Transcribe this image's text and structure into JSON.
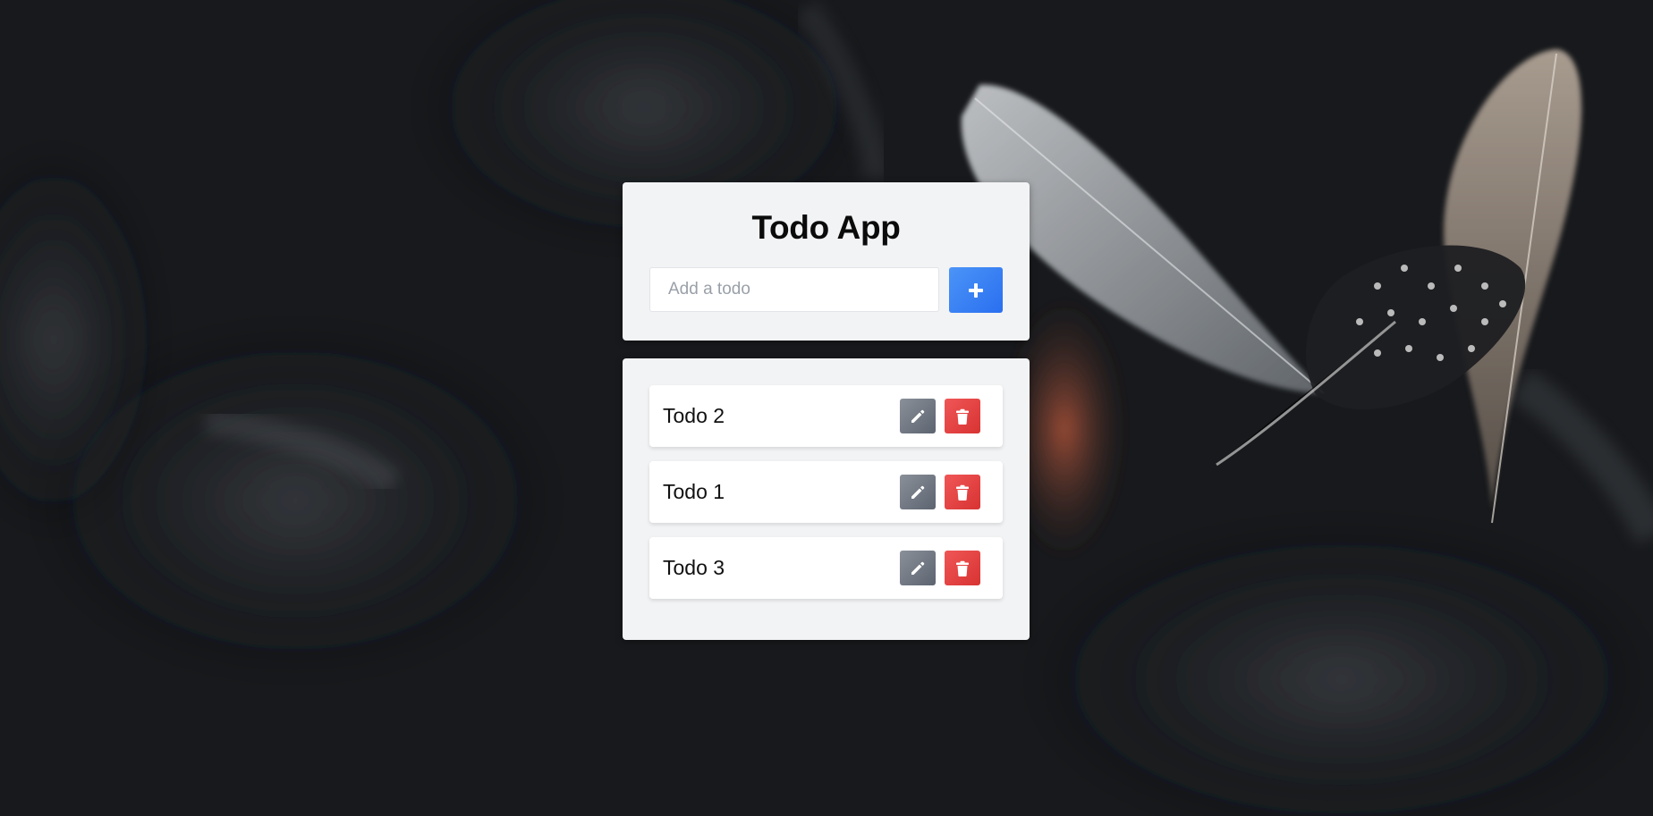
{
  "app": {
    "title": "Todo App"
  },
  "input": {
    "placeholder": "Add a todo",
    "value": ""
  },
  "icons": {
    "add": "plus-icon",
    "edit": "pencil-icon",
    "delete": "trash-icon"
  },
  "todos": [
    {
      "text": "Todo 2"
    },
    {
      "text": "Todo 1"
    },
    {
      "text": "Todo 3"
    }
  ],
  "colors": {
    "add_button": "#2f74f2",
    "edit_button": "#6b727c",
    "delete_button": "#e33f3f",
    "panel": "#f2f3f5",
    "background": "#15171a"
  }
}
